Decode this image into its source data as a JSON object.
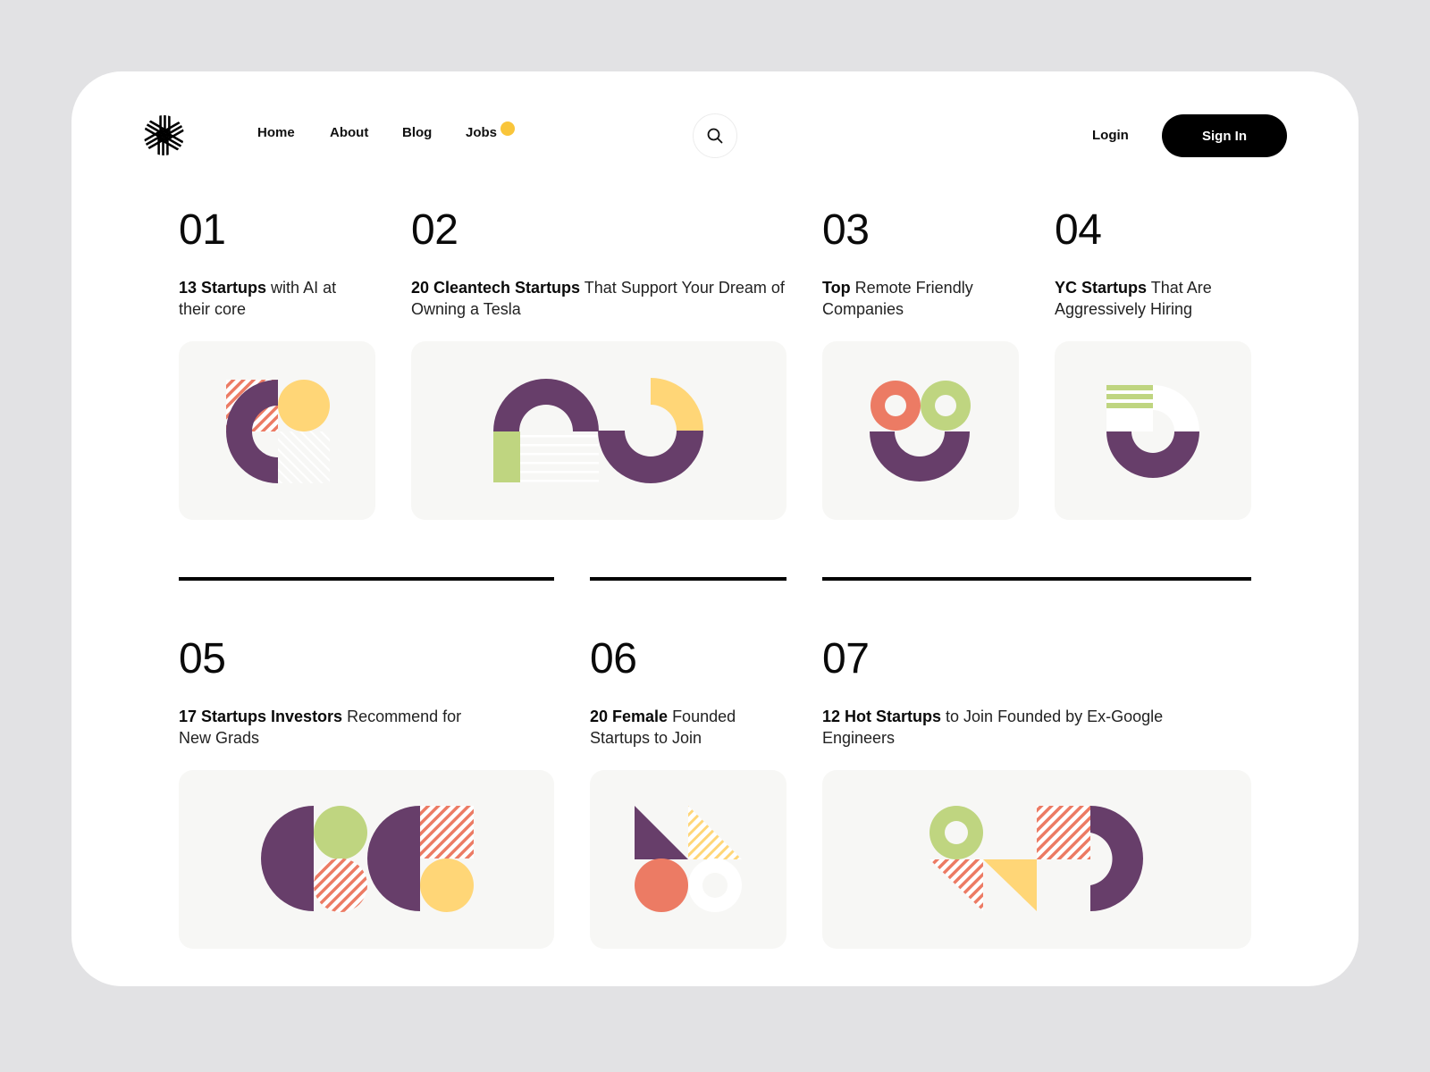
{
  "nav": {
    "logo_icon": "woven-knot-logo",
    "home": "Home",
    "about": "About",
    "blog": "Blog",
    "jobs": "Jobs",
    "search_icon": "search-icon",
    "login": "Login",
    "signin": "Sign In"
  },
  "colors": {
    "purple": "#673e6a",
    "yellow": "#ffd677",
    "salmon": "#ec7b64",
    "green": "#bfd580",
    "dot": "#f9c53a",
    "card_bg": "#f7f7f5"
  },
  "cards": [
    {
      "number": "01",
      "bold": "13 Startups",
      "rest": " with AI at their core"
    },
    {
      "number": "02",
      "bold": "20 Cleantech Startups",
      "rest": " That Support Your Dream of Owning a Tesla"
    },
    {
      "number": "03",
      "bold": "Top",
      "rest": " Remote Friendly Companies"
    },
    {
      "number": "04",
      "bold": "YC Startups",
      "rest": " That Are Aggressively Hiring"
    },
    {
      "number": "05",
      "bold": "17 Startups Investors",
      "rest": " Recommend for New Grads"
    },
    {
      "number": "06",
      "bold": "20 Female",
      "rest": " Founded Startups to Join"
    },
    {
      "number": "07",
      "bold": "12 Hot Startups",
      "rest": " to Join Founded by Ex-Google Engineers"
    }
  ]
}
